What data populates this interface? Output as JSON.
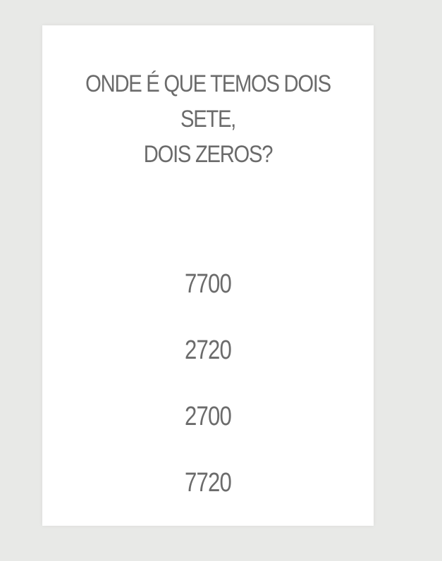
{
  "document": {
    "question_line_1": "ONDE É QUE TEMOS DOIS SETE,",
    "question_line_2": "DOIS ZEROS?",
    "options": [
      "7700",
      "2720",
      "2700",
      "7720"
    ]
  },
  "colors": {
    "background": "#e8e9e7",
    "paper": "#ffffff",
    "text": "#6b6b6b"
  }
}
